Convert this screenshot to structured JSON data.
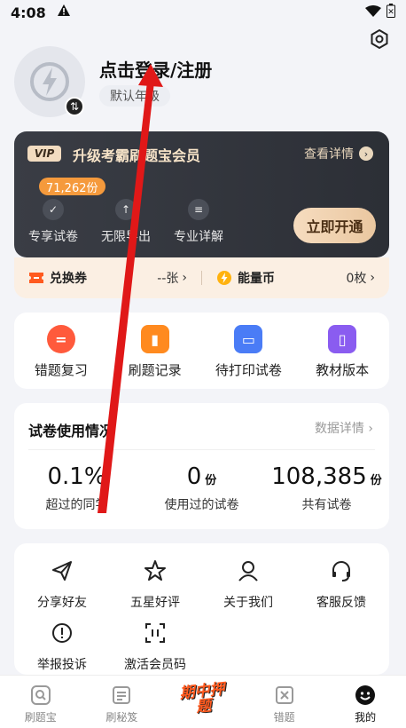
{
  "status_bar": {
    "time": "4:08"
  },
  "profile": {
    "login_text": "点击登录/注册",
    "grade_label": "默认年级"
  },
  "vip": {
    "badge": "VIP",
    "title": "升级考霸刷题宝会员",
    "detail_link": "查看详情",
    "count_badge": "71,262份",
    "features": [
      "专享试卷",
      "无限导出",
      "专业详解"
    ],
    "open_button": "立即开通"
  },
  "coupons": {
    "voucher_label": "兑换券",
    "voucher_value": "--张",
    "coin_label": "能量币",
    "coin_value": "0枚"
  },
  "quick_actions": [
    {
      "label": "错题复习",
      "icon": "review-icon",
      "color": "#ff5a3c"
    },
    {
      "label": "刷题记录",
      "icon": "record-icon",
      "color": "#ff8a1f"
    },
    {
      "label": "待打印试卷",
      "icon": "printer-icon",
      "color": "#4a7cf6"
    },
    {
      "label": "教材版本",
      "icon": "book-icon",
      "color": "#8a5cf0"
    }
  ],
  "stats": {
    "title": "试卷使用情况",
    "detail_link": "数据详情",
    "items": [
      {
        "value": "0.1%",
        "unit": "",
        "label": "超过的同学"
      },
      {
        "value": "0",
        "unit": "份",
        "label": "使用过的试卷"
      },
      {
        "value": "108,385",
        "unit": "份",
        "label": "共有试卷"
      }
    ]
  },
  "menu": [
    {
      "label": "分享好友",
      "icon": "share-icon"
    },
    {
      "label": "五星好评",
      "icon": "star-icon"
    },
    {
      "label": "关于我们",
      "icon": "user-icon"
    },
    {
      "label": "客服反馈",
      "icon": "headset-icon"
    },
    {
      "label": "举报投诉",
      "icon": "report-icon"
    },
    {
      "label": "激活会员码",
      "icon": "scan-icon"
    }
  ],
  "tabs": [
    {
      "label": "刷题宝",
      "icon": "search-book-icon"
    },
    {
      "label": "刷秘笈",
      "icon": "scroll-icon"
    },
    {
      "label": "期中押题",
      "icon": "promo-icon"
    },
    {
      "label": "错题",
      "icon": "wrong-book-icon"
    },
    {
      "label": "我的",
      "icon": "smile-icon"
    }
  ]
}
